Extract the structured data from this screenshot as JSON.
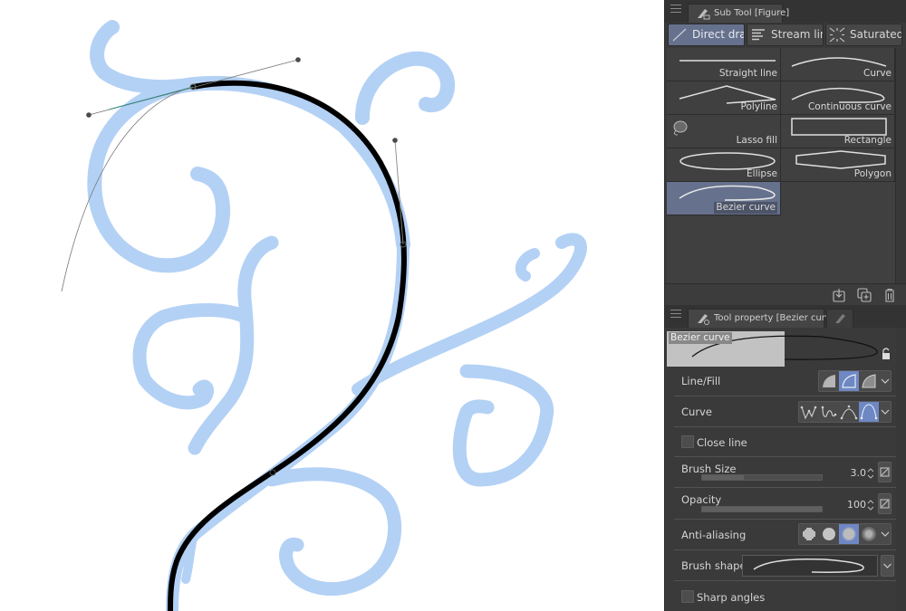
{
  "canvas": {
    "colors": {
      "sketch": "#b3d1f5",
      "stroke": "#000000",
      "guide": "#777777",
      "guide_accent": "#2a8a80",
      "handle": "#4a4a4a"
    }
  },
  "subtool_panel": {
    "tab_label": "Sub Tool [Figure]",
    "tab_icon": "figure-tool-icon",
    "groups": [
      {
        "label": "Direct draw",
        "icon": "direct-draw-icon",
        "selected": true
      },
      {
        "label": "Stream line",
        "icon": "stream-line-icon",
        "selected": false
      },
      {
        "label": "Saturated line",
        "icon": "saturated-line-icon",
        "selected": false
      }
    ],
    "items": [
      {
        "label": "Straight line",
        "icon": "straight-line-icon",
        "selected": false
      },
      {
        "label": "Curve",
        "icon": "curve-icon",
        "selected": false
      },
      {
        "label": "Polyline",
        "icon": "polyline-icon",
        "selected": false
      },
      {
        "label": "Continuous curve",
        "icon": "continuous-curve-icon",
        "selected": false
      },
      {
        "label": "Lasso fill",
        "icon": "lasso-fill-icon",
        "selected": false
      },
      {
        "label": "Rectangle",
        "icon": "rectangle-icon",
        "selected": false
      },
      {
        "label": "Ellipse",
        "icon": "ellipse-icon",
        "selected": false
      },
      {
        "label": "Polygon",
        "icon": "polygon-icon",
        "selected": false
      },
      {
        "label": "Bezier curve",
        "icon": "bezier-curve-icon",
        "selected": true
      }
    ],
    "footer_icons": [
      "import-icon",
      "duplicate-icon",
      "trash-icon"
    ],
    "selected_color": "#66718d"
  },
  "property_panel": {
    "tab_label": "Tool property [Bezier curve]",
    "preview_label": "Bezier curve",
    "line_fill": {
      "label": "Line/Fill",
      "options": [
        "Fill",
        "Line",
        "Line and fill"
      ],
      "selected_index": 1
    },
    "curve": {
      "label": "Curve",
      "options": [
        "Straight line",
        "Spline",
        "Quadratic bezier",
        "Cubic bezier"
      ],
      "selected_index": 3
    },
    "close_line": {
      "label": "Close line",
      "checked": false
    },
    "brush_size": {
      "label": "Brush Size",
      "value": "3.0",
      "slider_fraction": 0.35
    },
    "opacity": {
      "label": "Opacity",
      "value": "100",
      "slider_fraction": 1.0
    },
    "anti_aliasing": {
      "label": "Anti-aliasing",
      "options": [
        "None",
        "Weak",
        "Middle",
        "Strong"
      ],
      "selected_index": 2
    },
    "brush_shape": {
      "label": "Brush shape"
    },
    "sharp_angles": {
      "label": "Sharp angles",
      "checked": false
    },
    "accent_color": "#6e88c4"
  }
}
